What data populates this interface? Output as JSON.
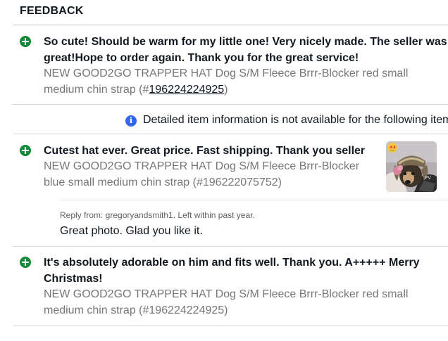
{
  "section": {
    "title": "FEEDBACK"
  },
  "info_notice": {
    "icon": "info-icon",
    "text": "Detailed item information is not available for the following item"
  },
  "entries": [
    {
      "rating_icon": "positive-plus-icon",
      "comment_line1": "So cute! Should be warm for my little one! Very nicely made. The seller was",
      "comment_line2": "great!Hope to order again. Thank you for the great service!",
      "item_line1": "NEW GOOD2GO TRAPPER HAT Dog S/M Fleece Brrr-Blocker red small",
      "item_line2_prefix": "medium chin strap (#",
      "item_number": "196224224925",
      "item_line2_suffix": ")"
    },
    {
      "rating_icon": "positive-plus-icon",
      "comment_line1": "Cutest hat ever. Great price. Fast shipping. Thank you seller",
      "item_line1": "NEW GOOD2GO TRAPPER HAT Dog S/M Fleece Brrr-Blocker",
      "item_line2": "blue small medium chin strap (#196222075752)",
      "photo": "dog-wearing-trapper-hat-photo",
      "reply": {
        "meta": "Reply from: gregoryandsmith1. Left within past year.",
        "text": "Great photo. Glad you like it."
      }
    },
    {
      "rating_icon": "positive-plus-icon",
      "comment_line1": "It's absolutely adorable on him and fits well. Thank you. A+++++ Merry",
      "comment_line2": "Christmas!",
      "item_line1": "NEW GOOD2GO TRAPPER HAT Dog S/M Fleece Brrr-Blocker red small",
      "item_line2": "medium chin strap (#196224224925)"
    }
  ],
  "colors": {
    "positive": "#138a36",
    "info": "#3665f3",
    "muted_text": "#767676",
    "divider": "#d6d6d6"
  }
}
